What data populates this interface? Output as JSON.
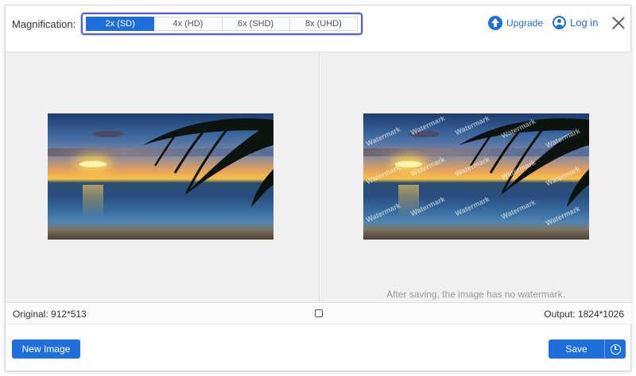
{
  "header": {
    "magnification_label": "Magnification:",
    "magnification_options": [
      "2x (SD)",
      "4x (HD)",
      "6x (SHD)",
      "8x (UHD)"
    ],
    "selected_magnification": "2x (SD)",
    "upgrade_label": "Upgrade",
    "login_label": "Log in"
  },
  "preview": {
    "watermark_text": "Watermark",
    "note": "After saving, the image has no watermark."
  },
  "info": {
    "original": "Original: 912*513",
    "output": "Output: 1824*1026"
  },
  "footer": {
    "new_image_label": "New Image",
    "save_label": "Save"
  },
  "colors": {
    "accent": "#1e6fd9",
    "selector_outline": "#5b5fd6",
    "preview_background": "#f0f0f0"
  }
}
